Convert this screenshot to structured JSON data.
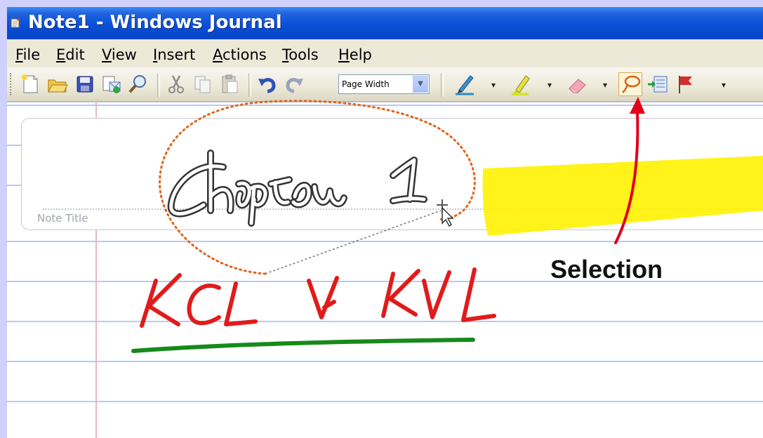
{
  "window": {
    "title": "Note1 - Windows Journal"
  },
  "menu": [
    "File",
    "Edit",
    "View",
    "Insert",
    "Actions",
    "Tools",
    "Help"
  ],
  "toolbar": {
    "buttons": [
      "new-note-icon",
      "open-icon",
      "save-icon",
      "send-icon",
      "find-icon",
      "cut-icon",
      "copy-icon",
      "paste-icon",
      "undo-icon",
      "redo-icon",
      "pen-icon",
      "highlighter-icon",
      "eraser-icon",
      "selection-tool-icon",
      "insert-space-icon",
      "flag-icon"
    ],
    "zoom_value": "Page Width"
  },
  "note": {
    "title_placeholder": "Note Title"
  },
  "annotation": {
    "label": "Selection"
  },
  "colors": {
    "title_bar": "#0a4fd8",
    "highlight": "#fff200",
    "annotation_arrow": "#e0001b",
    "ink_red": "#e01b1b",
    "ink_green": "#168a1a",
    "selection_lasso": "#e0651a"
  }
}
